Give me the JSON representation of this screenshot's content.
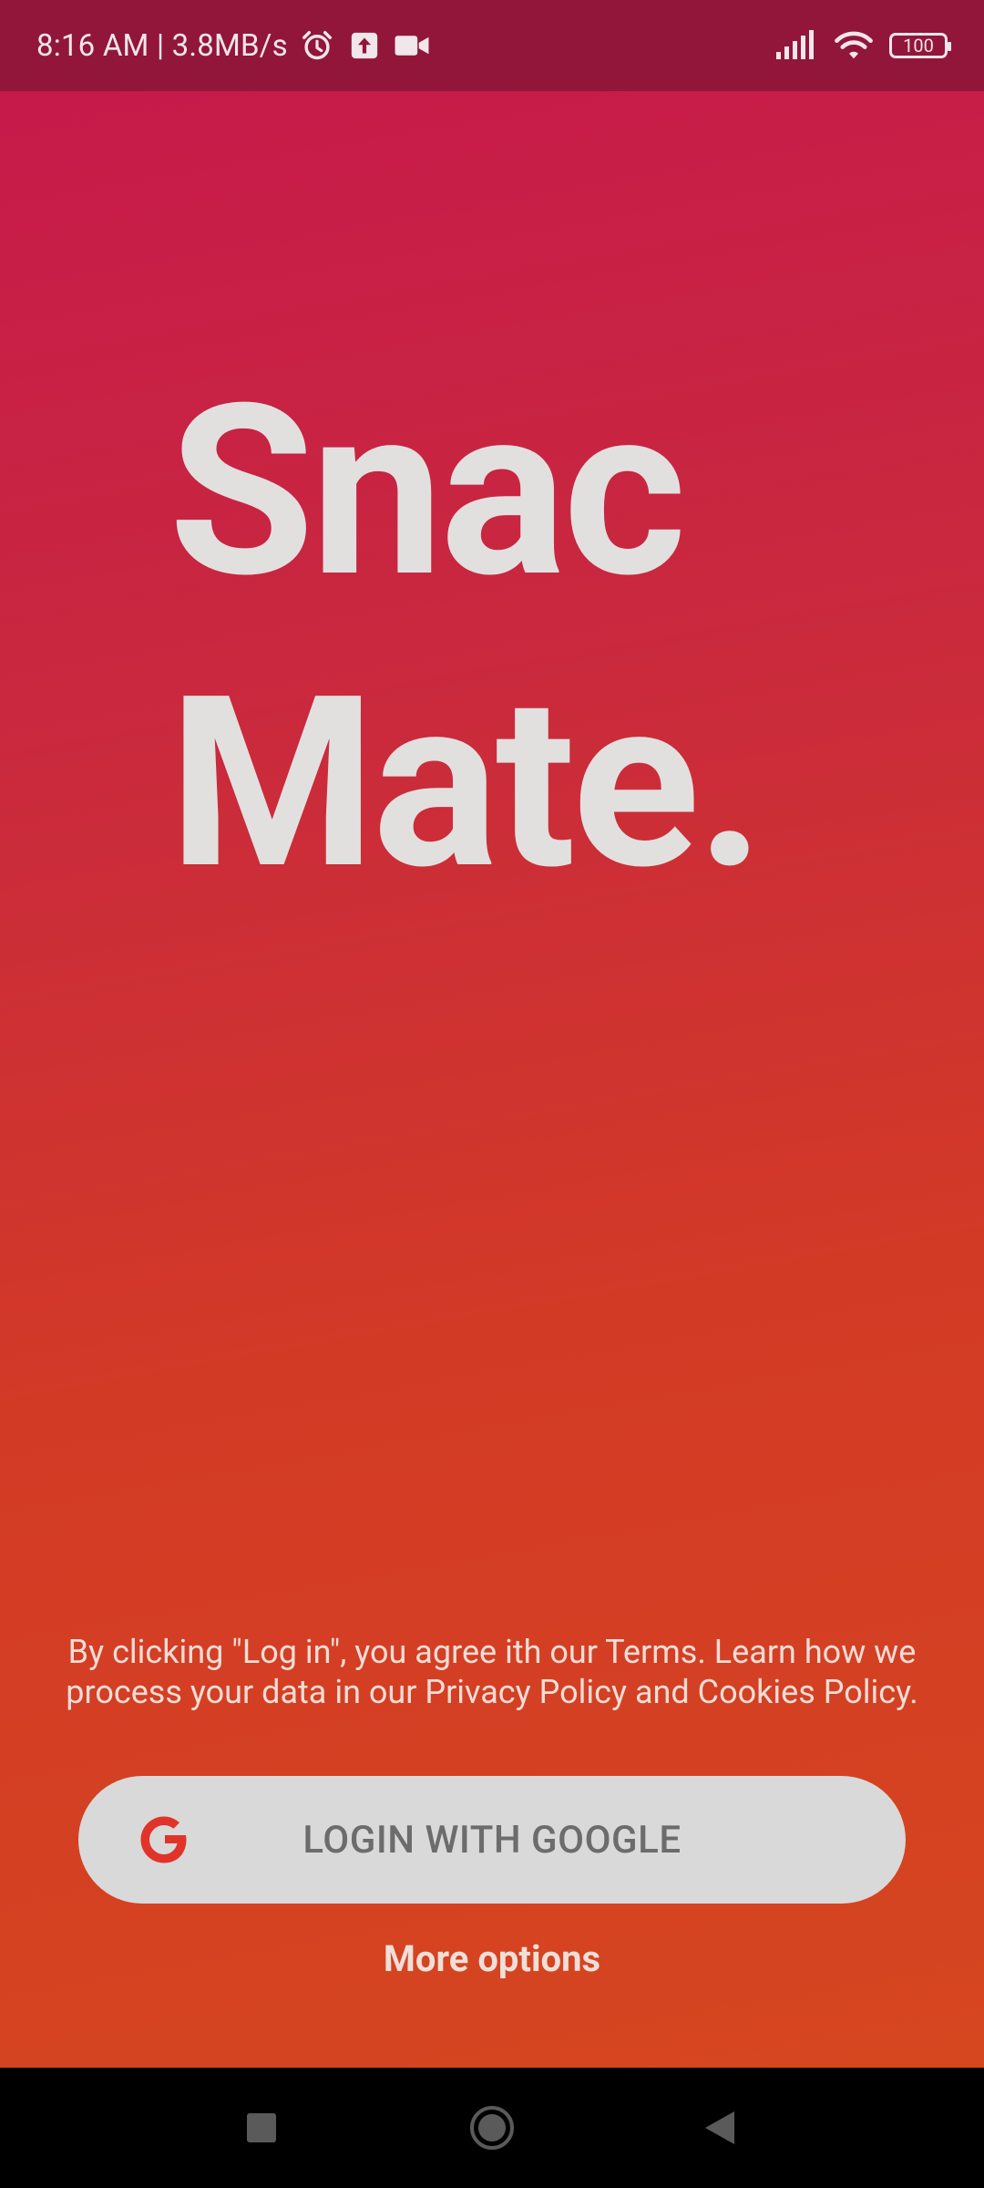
{
  "status_bar": {
    "time_network": "8:16 AM | 3.8MB/s",
    "battery": "100",
    "icons": [
      "alarm-icon",
      "upload-icon",
      "video-icon",
      "signal-icon",
      "wifi-icon",
      "battery-icon"
    ]
  },
  "logo": {
    "line1": "Snac",
    "line2": "Mate."
  },
  "legal_text": "By clicking \"Log in\", you agree ith our Terms. Learn how we process your data in our Privacy Policy and Cookies Policy.",
  "google_button": {
    "label": "LOGIN WITH GOOGLE",
    "icon": "google-icon"
  },
  "more_options": "More options",
  "colors": {
    "gradient_top": "#c6184c",
    "gradient_bottom": "#d6481e",
    "status_bar": "#92163a",
    "button_bg": "#d9d9d9",
    "google_red": "#e0342a"
  },
  "nav_bar": {
    "icons": [
      "recents-icon",
      "home-icon",
      "back-icon"
    ]
  }
}
